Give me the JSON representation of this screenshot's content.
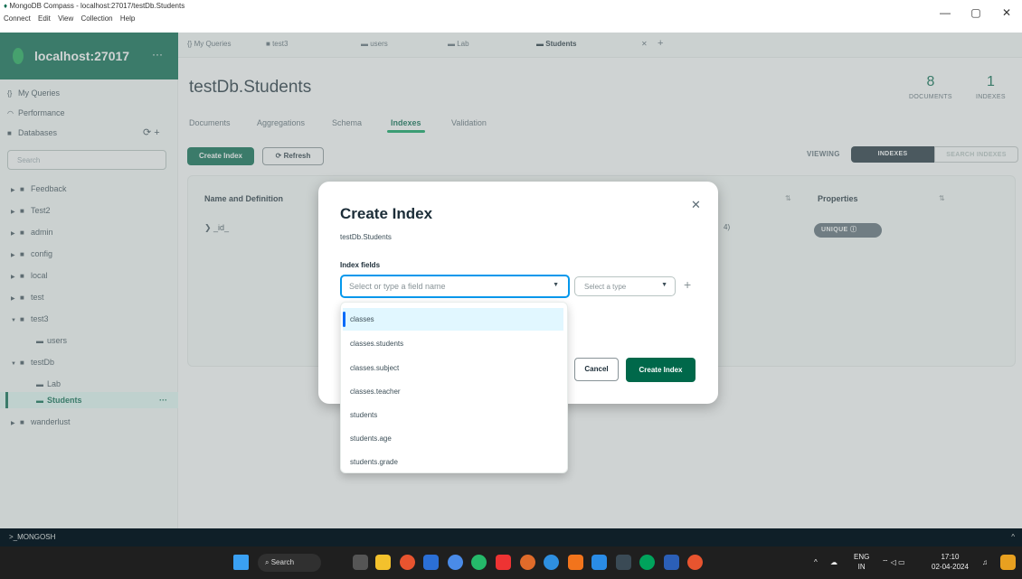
{
  "window": {
    "title": "MongoDB Compass - localhost:27017/testDb.Students",
    "menu": [
      "Connect",
      "Edit",
      "View",
      "Collection",
      "Help"
    ],
    "controls": [
      "—",
      "▢",
      "✕"
    ]
  },
  "sidebar": {
    "connection": "localhost:27017",
    "connection_menu": "···",
    "nav": [
      {
        "label": "My Queries",
        "icon": "{}"
      },
      {
        "label": "Performance",
        "icon": "◠"
      },
      {
        "label": "Databases",
        "icon": "■"
      }
    ],
    "db_actions": "⟳ +",
    "search_placeholder": "Search",
    "tree": [
      {
        "label": "Feedback",
        "level": 0,
        "expanded": false
      },
      {
        "label": "Test2",
        "level": 0,
        "expanded": false
      },
      {
        "label": "admin",
        "level": 0,
        "expanded": false
      },
      {
        "label": "config",
        "level": 0,
        "expanded": false
      },
      {
        "label": "local",
        "level": 0,
        "expanded": false
      },
      {
        "label": "test",
        "level": 0,
        "expanded": false
      },
      {
        "label": "test3",
        "level": 0,
        "expanded": true
      },
      {
        "label": "users",
        "level": 1
      },
      {
        "label": "testDb",
        "level": 0,
        "expanded": true
      },
      {
        "label": "Lab",
        "level": 1
      },
      {
        "label": "Students",
        "level": 1,
        "active": true
      },
      {
        "label": "wanderlust",
        "level": 0,
        "expanded": false
      }
    ],
    "active_menu": "···"
  },
  "tabs": [
    {
      "label": "{} My Queries"
    },
    {
      "label": "test3"
    },
    {
      "label": "users"
    },
    {
      "label": "Lab"
    },
    {
      "label": "Students",
      "active": true
    }
  ],
  "tab_close": "✕",
  "tab_add": "+",
  "collection": {
    "title": "testDb.Students",
    "documents_count": "8",
    "documents_label": "DOCUMENTS",
    "indexes_count": "1",
    "indexes_label": "INDEXES"
  },
  "subtabs": [
    "Documents",
    "Aggregations",
    "Schema",
    "Indexes",
    "Validation"
  ],
  "toolbar": {
    "create_index": "Create Index",
    "refresh": "Refresh",
    "viewing": "VIEWING",
    "seg_indexes": "INDEXES",
    "seg_search": "SEARCH INDEXES"
  },
  "table": {
    "headers": [
      "Name and Definition",
      "Properties"
    ],
    "row_name": "_id_",
    "row_partial": "4)",
    "badge": "UNIQUE"
  },
  "modal": {
    "title": "Create Index",
    "subtitle": "testDb.Students",
    "fields_label": "Index fields",
    "field_placeholder": "Select or type a field name",
    "type_placeholder": "Select a type",
    "cancel": "Cancel",
    "create": "Create Index",
    "close": "✕"
  },
  "dropdown": [
    "classes",
    "classes.students",
    "classes.subject",
    "classes.teacher",
    "students",
    "students.age",
    "students.grade"
  ],
  "shell": {
    "label": ">_MONGOSH",
    "chevron": "^"
  },
  "taskbar": {
    "search": "Search",
    "lang": "ENG",
    "region": "IN",
    "time": "17:10",
    "date": "02-04-2024"
  },
  "colors": {
    "brand": "#00684a",
    "accent": "#00a35c",
    "focus": "#0498ec"
  }
}
